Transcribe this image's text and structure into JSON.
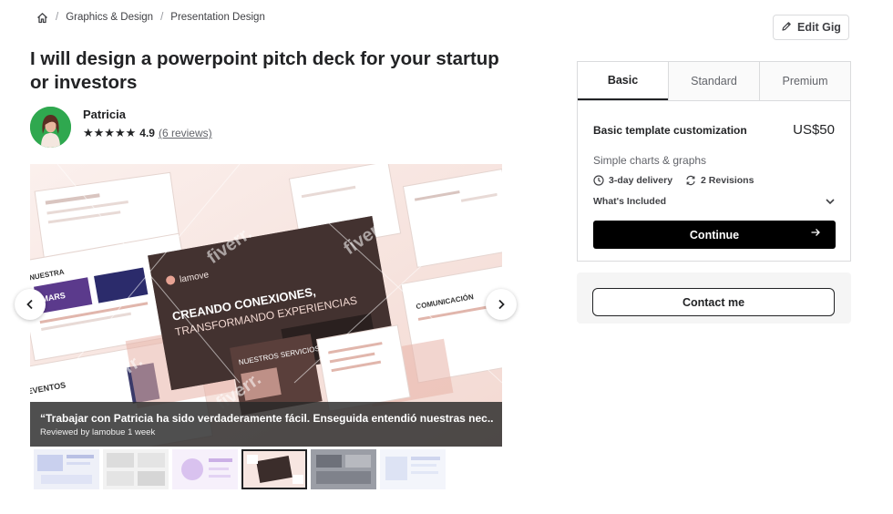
{
  "breadcrumb": {
    "home_icon": "home-icon",
    "items": [
      "Graphics & Design",
      "Presentation Design"
    ]
  },
  "edit_button": {
    "label": "Edit Gig",
    "icon": "pencil-icon"
  },
  "gig": {
    "title": "I will design a powerpoint pitch deck for your startup or investors"
  },
  "seller": {
    "name": "Patricia",
    "rating": "4.9",
    "reviews": "(6 reviews)",
    "star_count": 5
  },
  "gallery": {
    "slide_brand": "lamove",
    "slide_headline_1": "CREANDO CONEXIONES,",
    "slide_headline_2": "TRANSFORMANDO EXPERIENCIAS",
    "slide_services": "NUESTROS SERVICIOS",
    "slide_nuestra": "NUESTRA",
    "slide_mars": "MARS",
    "slide_comunicacion": "COMUNICACIÓN",
    "slide_eventos": "EVENTOS",
    "watermark": "fiverr.",
    "review_quote": "“Trabajar con Patricia ha sido verdaderamente fácil. Enseguida entendió nuestras nec...",
    "review_meta": "Reviewed by lamobue 1 week",
    "thumbnail_count": 6
  },
  "package": {
    "tabs": [
      "Basic",
      "Standard",
      "Premium"
    ],
    "active_tab": "Basic",
    "name": "Basic template customization",
    "price": "US$50",
    "description": "Simple charts & graphs",
    "delivery": "3-day delivery",
    "revisions": "2 Revisions",
    "included": "What's Included",
    "continue": "Continue"
  },
  "contact": {
    "label": "Contact me"
  },
  "colors": {
    "primary": "#000000",
    "star": "#222325",
    "accent_salmon": "#e8b3a8",
    "avatar_bg": "#2fa84f"
  }
}
